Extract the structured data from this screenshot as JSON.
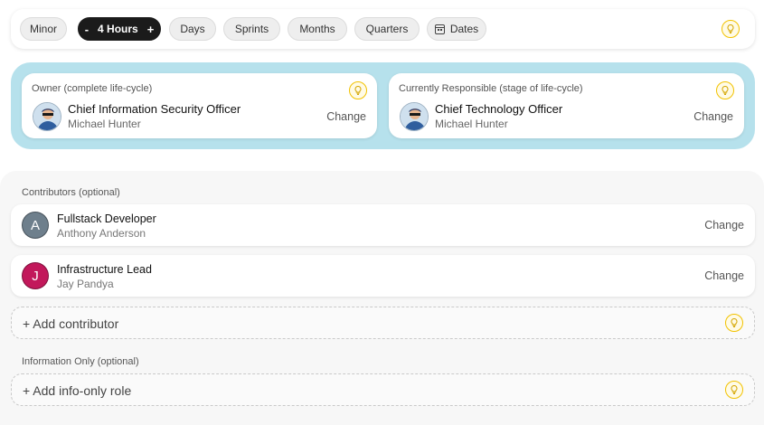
{
  "toolbar": {
    "pills": [
      "Minor",
      "Days",
      "Sprints",
      "Months",
      "Quarters"
    ],
    "active": {
      "minus": "-",
      "label": "4 Hours",
      "plus": "+"
    },
    "dates_label": "Dates"
  },
  "owner": {
    "caption": "Owner (complete life-cycle)",
    "role": "Chief Information Security Officer",
    "person": "Michael Hunter",
    "change_label": "Change"
  },
  "responsible": {
    "caption": "Currently Responsible (stage of life-cycle)",
    "role": "Chief Technology Officer",
    "person": "Michael Hunter",
    "change_label": "Change"
  },
  "contributors": {
    "label": "Contributors (optional)",
    "items": [
      {
        "initial": "A",
        "role": "Fullstack Developer",
        "person": "Anthony Anderson",
        "change_label": "Change",
        "color": "#6e7f8c"
      },
      {
        "initial": "J",
        "role": "Infrastructure Lead",
        "person": "Jay Pandya",
        "change_label": "Change",
        "color": "#c2185b"
      }
    ],
    "add_label": "+ Add contributor"
  },
  "info_only": {
    "label": "Information Only (optional)",
    "add_label": "+ Add info-only role"
  },
  "colors": {
    "accent_panel": "#b6e1ec",
    "active_pill": "#1b1b1b",
    "bulb": "#f2c200"
  },
  "icons": [
    "lightbulb-icon",
    "calendar-icon"
  ]
}
